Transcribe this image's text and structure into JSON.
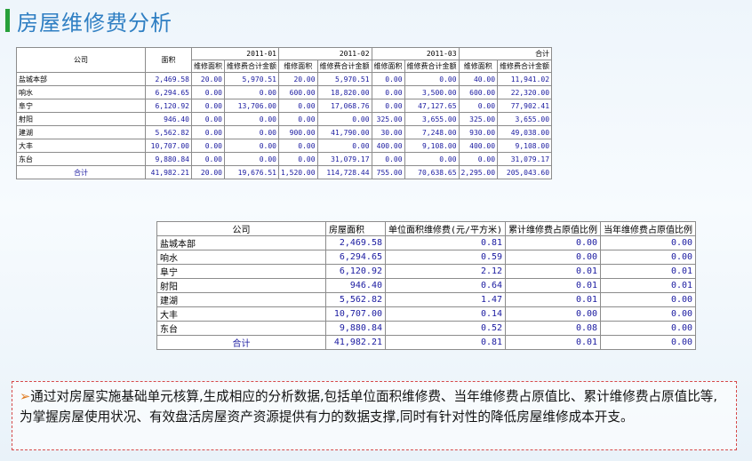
{
  "title": "房屋维修费分析",
  "table1": {
    "company_header": "公司",
    "area_header": "面积",
    "periods": [
      "2011-01",
      "2011-02",
      "2011-03",
      "合计"
    ],
    "sub_headers": [
      "维修面积",
      "维修费合计金额"
    ],
    "rows": [
      {
        "company": "盐城本部",
        "area": "2,469.58",
        "vals": [
          "20.00",
          "5,970.51",
          "20.00",
          "5,970.51",
          "0.00",
          "0.00",
          "40.00",
          "11,941.02"
        ]
      },
      {
        "company": "响水",
        "area": "6,294.65",
        "vals": [
          "0.00",
          "0.00",
          "600.00",
          "18,820.00",
          "0.00",
          "3,500.00",
          "600.00",
          "22,320.00"
        ]
      },
      {
        "company": "阜宁",
        "area": "6,120.92",
        "vals": [
          "0.00",
          "13,706.00",
          "0.00",
          "17,068.76",
          "0.00",
          "47,127.65",
          "0.00",
          "77,902.41"
        ]
      },
      {
        "company": "射阳",
        "area": "946.40",
        "vals": [
          "0.00",
          "0.00",
          "0.00",
          "0.00",
          "325.00",
          "3,655.00",
          "325.00",
          "3,655.00"
        ]
      },
      {
        "company": "建湖",
        "area": "5,562.82",
        "vals": [
          "0.00",
          "0.00",
          "900.00",
          "41,790.00",
          "30.00",
          "7,248.00",
          "930.00",
          "49,038.00"
        ]
      },
      {
        "company": "大丰",
        "area": "10,707.00",
        "vals": [
          "0.00",
          "0.00",
          "0.00",
          "0.00",
          "400.00",
          "9,108.00",
          "400.00",
          "9,108.00"
        ]
      },
      {
        "company": "东台",
        "area": "9,880.84",
        "vals": [
          "0.00",
          "0.00",
          "0.00",
          "31,079.17",
          "0.00",
          "0.00",
          "0.00",
          "31,079.17"
        ]
      }
    ],
    "total": {
      "company": "合计",
      "area": "41,982.21",
      "vals": [
        "20.00",
        "19,676.51",
        "1,520.00",
        "114,728.44",
        "755.00",
        "70,638.65",
        "2,295.00",
        "205,043.60"
      ]
    }
  },
  "table2": {
    "headers": [
      "公司",
      "房屋面积",
      "单位面积维修费(元/平方米)",
      "累计维修费占原值比例",
      "当年维修费占原值比例"
    ],
    "rows": [
      {
        "company": "盐城本部",
        "area": "2,469.58",
        "unit": "0.81",
        "cum": "0.00",
        "year": "0.00"
      },
      {
        "company": "响水",
        "area": "6,294.65",
        "unit": "0.59",
        "cum": "0.00",
        "year": "0.00"
      },
      {
        "company": "阜宁",
        "area": "6,120.92",
        "unit": "2.12",
        "cum": "0.01",
        "year": "0.01"
      },
      {
        "company": "射阳",
        "area": "946.40",
        "unit": "0.64",
        "cum": "0.01",
        "year": "0.01"
      },
      {
        "company": "建湖",
        "area": "5,562.82",
        "unit": "1.47",
        "cum": "0.01",
        "year": "0.00"
      },
      {
        "company": "大丰",
        "area": "10,707.00",
        "unit": "0.14",
        "cum": "0.00",
        "year": "0.00"
      },
      {
        "company": "东台",
        "area": "9,880.84",
        "unit": "0.52",
        "cum": "0.08",
        "year": "0.00"
      }
    ],
    "total": {
      "company": "合计",
      "area": "41,982.21",
      "unit": "0.81",
      "cum": "0.01",
      "year": "0.00"
    }
  },
  "note": {
    "arrow": "➢",
    "text": "通过对房屋实施基础单元核算,生成相应的分析数据,包括单位面积维修费、当年维修费占原值比、累计维修费占原值比等,为掌握房屋使用状况、有效盘活房屋资产资源提供有力的数据支撑,同时有针对性的降低房屋维修成本开支。"
  }
}
